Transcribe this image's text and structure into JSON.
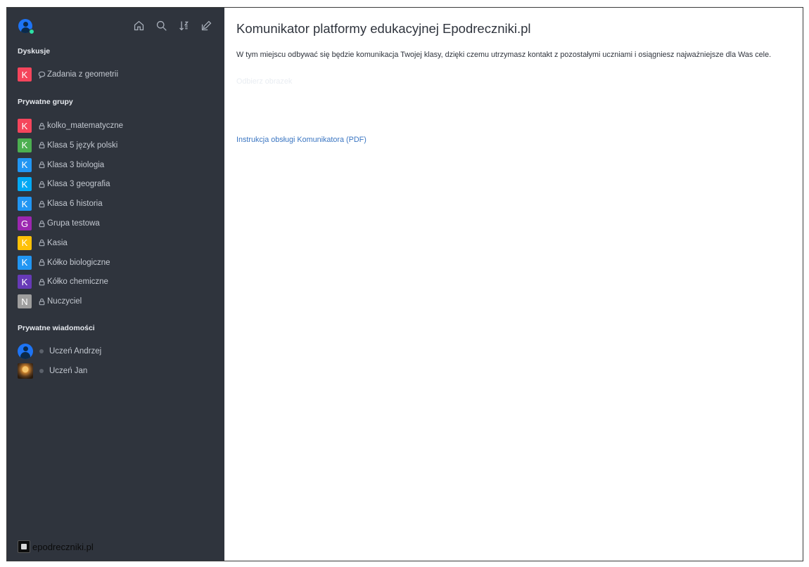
{
  "sidebar": {
    "header_icons": [
      "home-icon",
      "search-icon",
      "sort-icon",
      "edit-icon"
    ],
    "sections": {
      "discussions": {
        "title": "Dyskusje",
        "items": [
          {
            "letter": "K",
            "color": "#f5455c",
            "type": "discussion",
            "label": "Zadania z geometrii"
          }
        ]
      },
      "private_groups": {
        "title": "Prywatne grupy",
        "items": [
          {
            "letter": "K",
            "color": "#f5455c",
            "type": "lock",
            "label": "kolko_matematyczne"
          },
          {
            "letter": "K",
            "color": "#4caf50",
            "type": "lock",
            "label": "Klasa 5 język polski"
          },
          {
            "letter": "K",
            "color": "#2196f3",
            "type": "lock",
            "label": "Klasa 3 biologia"
          },
          {
            "letter": "K",
            "color": "#03a9f4",
            "type": "lock",
            "label": "Klasa 3 geografia"
          },
          {
            "letter": "K",
            "color": "#2196f3",
            "type": "lock",
            "label": "Klasa 6 historia"
          },
          {
            "letter": "G",
            "color": "#9c27b0",
            "type": "lock",
            "label": "Grupa testowa"
          },
          {
            "letter": "K",
            "color": "#ffc107",
            "type": "lock",
            "label": "Kasia"
          },
          {
            "letter": "K",
            "color": "#2196f3",
            "type": "lock",
            "label": "Kółko biologiczne"
          },
          {
            "letter": "K",
            "color": "#673ab7",
            "type": "lock",
            "label": "Kółko chemiczne"
          },
          {
            "letter": "N",
            "color": "#9e9e9e",
            "type": "lock",
            "label": "Nuczyciel"
          }
        ]
      },
      "private_messages": {
        "title": "Prywatne wiadomości",
        "items": [
          {
            "avatar": "user-avatar",
            "status": "offline",
            "label": "Uczeń Andrzej"
          },
          {
            "avatar": "photo-avatar",
            "status": "offline",
            "label": "Uczeń Jan"
          }
        ]
      }
    },
    "logo_text": "epodreczniki.pl"
  },
  "main": {
    "title": "Komunikator platformy edukacyjnej Epodreczniki.pl",
    "description": "W tym miejscu odbywać się będzie komunikacja Twojej klasy, dzięki czemu utrzymasz kontakt z pozostałymi uczniami i osiągniesz najważniejsze dla Was cele.",
    "faint_link": "Odbierz obrazek",
    "pdf_link": "Instrukcja obsługi Komunikatora (PDF)"
  }
}
